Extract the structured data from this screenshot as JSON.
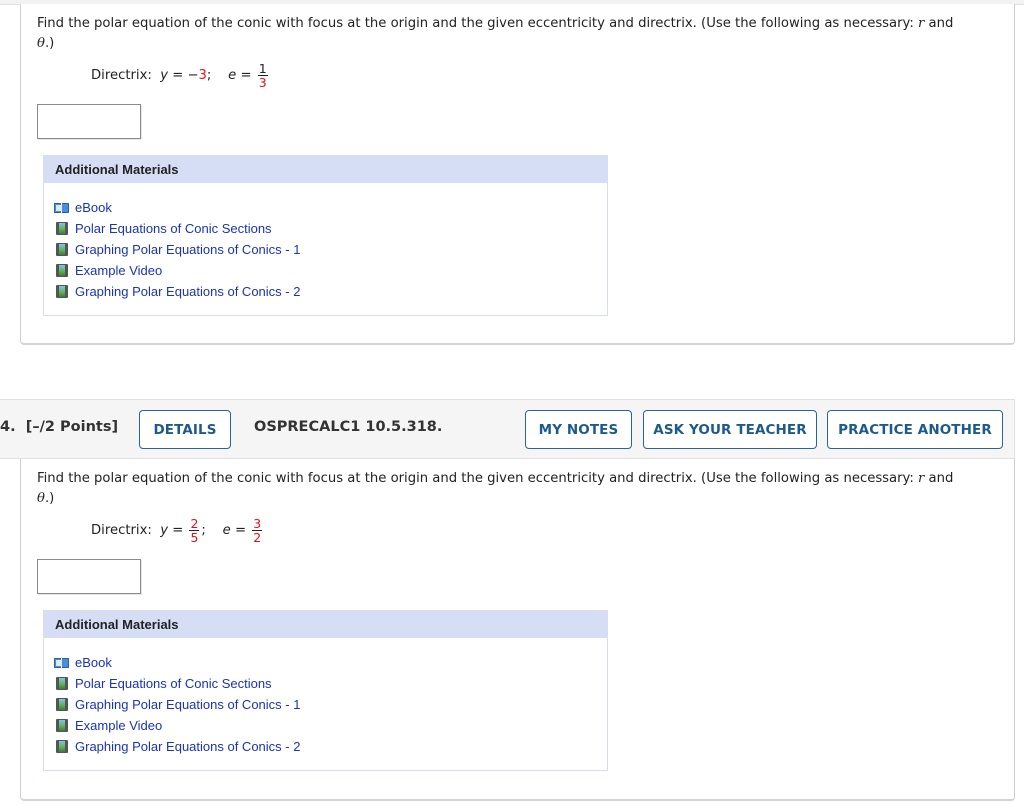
{
  "questions": [
    {
      "prompt_text": "Find the polar equation of the conic with focus at the origin and the given eccentricity and directrix. (Use the following as necessary: ",
      "prompt_var_r": "r",
      "prompt_and": " and",
      "prompt_theta": "θ",
      "prompt_end": ".)",
      "directrix_label": "Directrix:  ",
      "directrix_var": "y",
      "directrix_eq": " = ",
      "directrix_sign": "−",
      "directrix_value": "3",
      "directrix_sep": ";    ",
      "e_var": "e",
      "e_eq": " = ",
      "e_num": "1",
      "e_den": "3",
      "answer_value": "",
      "materials": {
        "title": "Additional Materials",
        "items": [
          {
            "icon": "book-icon",
            "label": "eBook"
          },
          {
            "icon": "video-icon",
            "label": "Polar Equations of Conic Sections"
          },
          {
            "icon": "video-icon",
            "label": "Graphing Polar Equations of Conics - 1"
          },
          {
            "icon": "video-icon",
            "label": "Example Video"
          },
          {
            "icon": "video-icon",
            "label": "Graphing Polar Equations of Conics - 2"
          }
        ]
      }
    },
    {
      "number": "4.  [–/2 Points]",
      "details_label": "DETAILS",
      "code": "OSPRECALC1 10.5.318.",
      "my_notes_label": "MY NOTES",
      "ask_teacher_label": "ASK YOUR TEACHER",
      "practice_label": "PRACTICE ANOTHER",
      "prompt_text": "Find the polar equation of the conic with focus at the origin and the given eccentricity and directrix. (Use the following as necessary: ",
      "prompt_var_r": "r",
      "prompt_and": " and",
      "prompt_theta": "θ",
      "prompt_end": ".)",
      "directrix_label": "Directrix:  ",
      "directrix_var": "y",
      "directrix_eq": " = ",
      "directrix_num": "2",
      "directrix_den": "5",
      "directrix_sep": ";    ",
      "e_var": "e",
      "e_eq": " = ",
      "e_num": "3",
      "e_den": "2",
      "answer_value": "",
      "materials": {
        "title": "Additional Materials",
        "items": [
          {
            "icon": "book-icon",
            "label": "eBook"
          },
          {
            "icon": "video-icon",
            "label": "Polar Equations of Conic Sections"
          },
          {
            "icon": "video-icon",
            "label": "Graphing Polar Equations of Conics - 1"
          },
          {
            "icon": "video-icon",
            "label": "Example Video"
          },
          {
            "icon": "video-icon",
            "label": "Graphing Polar Equations of Conics - 2"
          }
        ]
      }
    }
  ],
  "colors": {
    "accent_blue": "#1d5a8a",
    "link_blue": "#1a33b8",
    "highlight_red": "#e8111a",
    "materials_header_bg": "#d6def6"
  }
}
